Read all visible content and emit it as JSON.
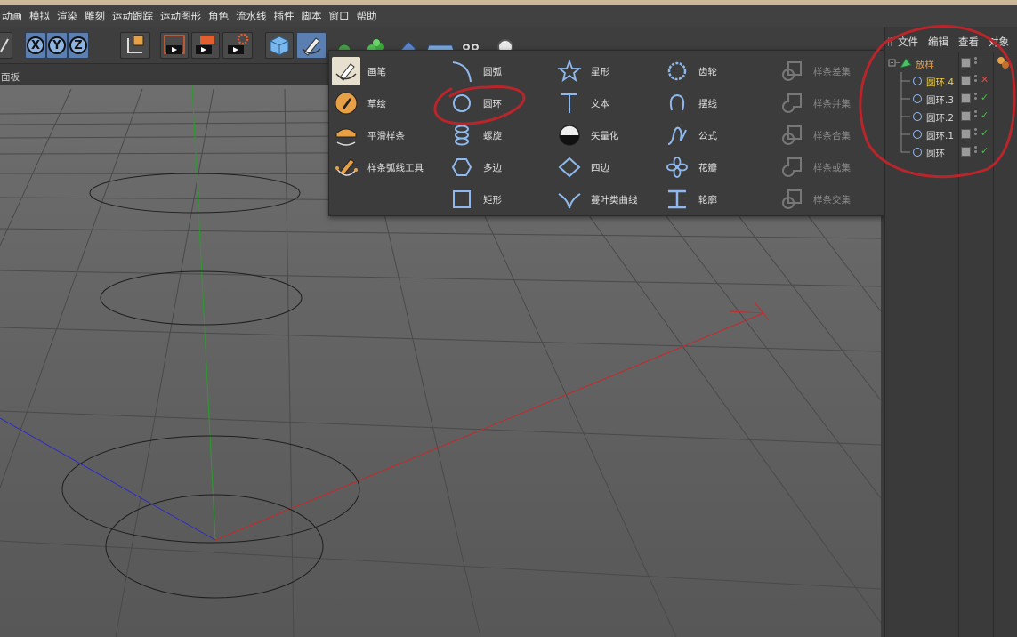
{
  "menubar": {
    "items": [
      "动画",
      "模拟",
      "渲染",
      "雕刻",
      "运动跟踪",
      "运动图形",
      "角色",
      "流水线",
      "插件",
      "脚本",
      "窗口",
      "帮助"
    ]
  },
  "toolbar": {
    "axis_x": "X",
    "axis_y": "Y",
    "axis_z": "Z"
  },
  "viewport": {
    "panel_label": "面板"
  },
  "spline_menu": {
    "col1": [
      {
        "label": "画笔",
        "icon": "pen-tool-icon"
      },
      {
        "label": "草绘",
        "icon": "sketch-icon"
      },
      {
        "label": "平滑样条",
        "icon": "smooth-spline-icon"
      },
      {
        "label": "样条弧线工具",
        "icon": "spline-arc-tool-icon"
      }
    ],
    "col2": [
      {
        "label": "圆弧",
        "icon": "arc-icon"
      },
      {
        "label": "圆环",
        "icon": "circle-icon"
      },
      {
        "label": "螺旋",
        "icon": "helix-icon"
      },
      {
        "label": "多边",
        "icon": "polygon-icon"
      },
      {
        "label": "矩形",
        "icon": "rectangle-icon"
      }
    ],
    "col3": [
      {
        "label": "星形",
        "icon": "star-icon"
      },
      {
        "label": "文本",
        "icon": "text-icon"
      },
      {
        "label": "矢量化",
        "icon": "vectorizer-icon"
      },
      {
        "label": "四边",
        "icon": "four-side-icon"
      },
      {
        "label": "蔓叶类曲线",
        "icon": "cissoid-icon"
      }
    ],
    "col4": [
      {
        "label": "齿轮",
        "icon": "cogwheel-icon"
      },
      {
        "label": "摆线",
        "icon": "cycloid-icon"
      },
      {
        "label": "公式",
        "icon": "formula-icon"
      },
      {
        "label": "花瓣",
        "icon": "flower-icon"
      },
      {
        "label": "轮廓",
        "icon": "profile-icon"
      }
    ],
    "col5": [
      {
        "label": "样条差集",
        "icon": "spline-subtract-icon"
      },
      {
        "label": "样条并集",
        "icon": "spline-union-icon"
      },
      {
        "label": "样条合集",
        "icon": "spline-and-icon"
      },
      {
        "label": "样条或集",
        "icon": "spline-or-icon"
      },
      {
        "label": "样条交集",
        "icon": "spline-intersect-icon"
      }
    ]
  },
  "object_manager": {
    "menu": [
      "文件",
      "编辑",
      "查看",
      "对象"
    ],
    "objects": [
      {
        "name": "放样",
        "icon": "loft-icon",
        "status": "",
        "highlight": "orange"
      },
      {
        "name": "圆环.4",
        "icon": "circle-icon",
        "status": "x",
        "highlight": "yellow"
      },
      {
        "name": "圆环.3",
        "icon": "circle-icon",
        "status": "ok",
        "highlight": ""
      },
      {
        "name": "圆环.2",
        "icon": "circle-icon",
        "status": "ok",
        "highlight": ""
      },
      {
        "name": "圆环.1",
        "icon": "circle-icon",
        "status": "ok",
        "highlight": ""
      },
      {
        "name": "圆环",
        "icon": "circle-icon",
        "status": "ok",
        "highlight": ""
      }
    ]
  },
  "colors": {
    "annotation": "#b8252b",
    "axis_x": "#c8282a",
    "axis_y": "#2e9a2e",
    "axis_z": "#2c2cc8",
    "highlight_orange": "#e8a046",
    "highlight_yellow": "#f2d040"
  }
}
